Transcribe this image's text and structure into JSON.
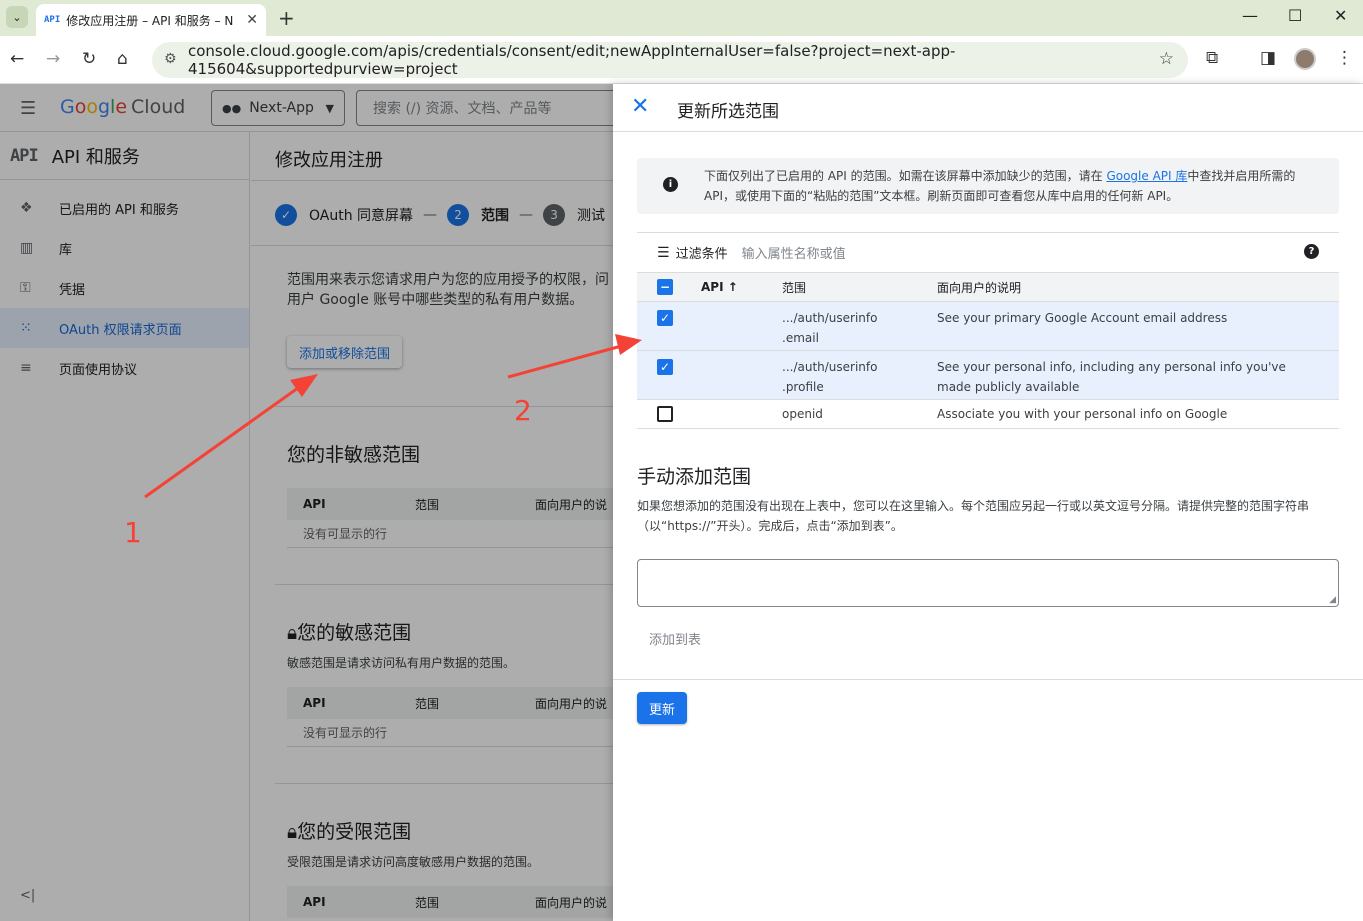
{
  "browser": {
    "tab_title": "修改应用注册 – API 和服务 – N",
    "tab_favicon": "API",
    "url": "console.cloud.google.com/apis/credentials/consent/edit;newAppInternalUser=false?project=next-app-415604&supportedpurview=project"
  },
  "console": {
    "logo_google": "Google",
    "logo_cloud": "Cloud",
    "project": "Next-App",
    "search_placeholder": "搜索 (/) 资源、文档、产品等",
    "sidenav": {
      "badge": "API",
      "title": "API 和服务",
      "items": [
        {
          "label": "已启用的 API 和服务",
          "icon": "❖"
        },
        {
          "label": "库",
          "icon": "▥"
        },
        {
          "label": "凭据",
          "icon": "⚿"
        },
        {
          "label": "OAuth 权限请求页面",
          "icon": "⁙"
        },
        {
          "label": "页面使用协议",
          "icon": "≡"
        }
      ],
      "collapse": "<|"
    },
    "page_title": "修改应用注册",
    "steps": [
      {
        "num": "✓",
        "label": "OAuth 同意屏幕"
      },
      {
        "num": "2",
        "label": "范围"
      },
      {
        "num": "3",
        "label": "测试"
      }
    ],
    "description": "范围用来表示您请求用户为您的应用授予的权限，问用户 Google 账号中哪些类型的私有用户数据。",
    "add_remove_button": "添加或移除范围",
    "sections": [
      {
        "title": "您的非敏感范围",
        "subtitle": "",
        "lock": false
      },
      {
        "title": "您的敏感范围",
        "subtitle": "敏感范围是请求访问私有用户数据的范围。",
        "lock": true
      },
      {
        "title": "您的受限范围",
        "subtitle": "受限范围是请求访问高度敏感用户数据的范围。",
        "lock": true
      }
    ],
    "table_headers": {
      "api": "API",
      "scope": "范围",
      "desc": "面向用户的说"
    },
    "no_rows": "没有可显示的行"
  },
  "annotations": {
    "one": "1",
    "two": "2",
    "color": "#f44336"
  },
  "panel": {
    "title": "更新所选范围",
    "info_pre": "下面仅列出了已启用的 API 的范围。如需在该屏幕中添加缺少的范围，请在 ",
    "info_link": "Google API 库",
    "info_post": "中查找并启用所需的 API，或使用下面的“粘贴的范围”文本框。刷新页面即可查看您从库中启用的任何新 API。",
    "filter_label": "过滤条件",
    "filter_placeholder": "输入属性名称或值",
    "headers": {
      "api": "API",
      "scope": "范围",
      "desc": "面向用户的说明"
    },
    "rows": [
      {
        "checked": true,
        "api": "",
        "scope_line1": ".../auth/userinfo",
        "scope_line2": ".email",
        "desc": "See your primary Google Account email address"
      },
      {
        "checked": true,
        "api": "",
        "scope_line1": ".../auth/userinfo",
        "scope_line2": ".profile",
        "desc": "See your personal info, including any personal info you've made publicly available"
      },
      {
        "checked": false,
        "api": "",
        "scope_line1": "openid",
        "scope_line2": "",
        "desc": "Associate you with your personal info on Google"
      }
    ],
    "manual_title": "手动添加范围",
    "manual_desc": "如果您想添加的范围没有出现在上表中，您可以在这里输入。每个范围应另起一行或以英文逗号分隔。请提供完整的范围字符串（以“https://”开头）。完成后，点击“添加到表”。",
    "add_to_table": "添加到表",
    "update_button": "更新"
  }
}
